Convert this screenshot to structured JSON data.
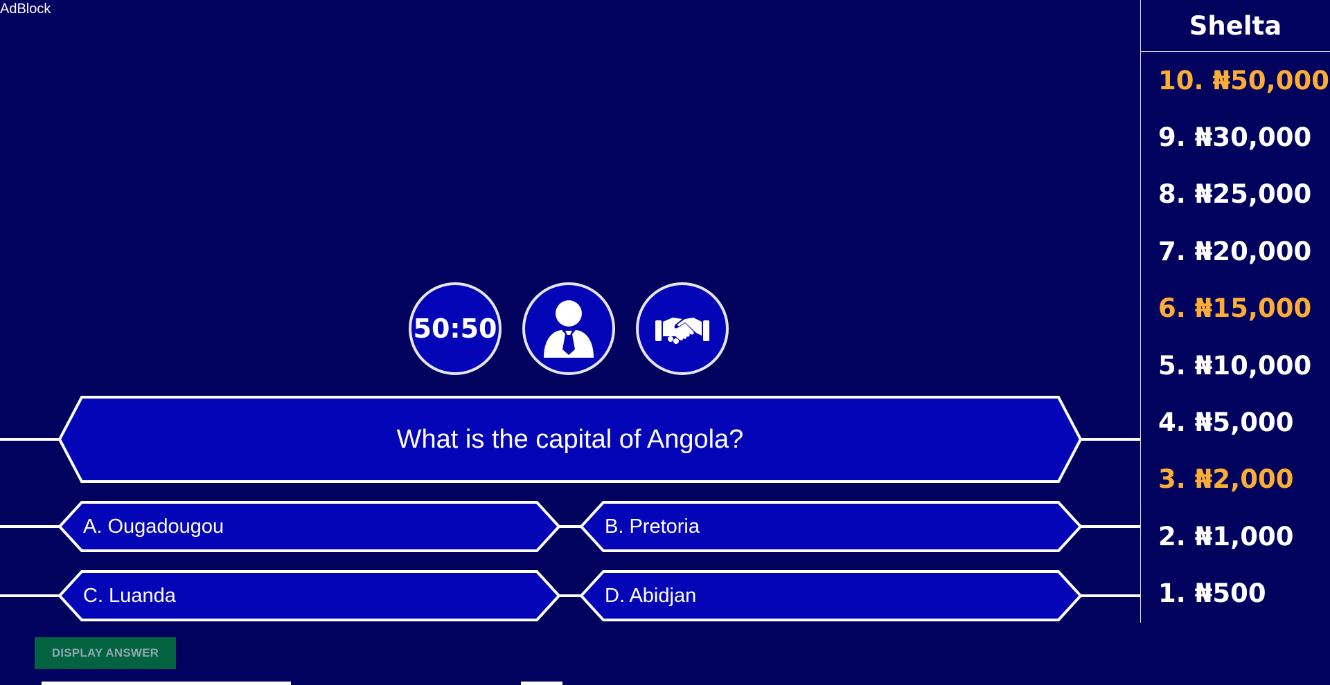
{
  "adblock_label": "AdBlock",
  "lifelines": {
    "fifty_fifty": "50:50",
    "ask_expert_icon": "person-with-tie-icon",
    "handshake_icon": "handshake-icon"
  },
  "question": {
    "text": "What is the capital of Angola?"
  },
  "answers": {
    "a": "A. Ougadougou",
    "b": "B. Pretoria",
    "c": "C. Luanda",
    "d": "D. Abidjan"
  },
  "display_answer_button": "DISPLAY ANSWER",
  "ladder": {
    "title": "Shelta",
    "items": [
      {
        "label": "10. ₦50,000",
        "milestone": true
      },
      {
        "label": "9. ₦30,000",
        "milestone": false
      },
      {
        "label": "8. ₦25,000",
        "milestone": false
      },
      {
        "label": "7. ₦20,000",
        "milestone": false
      },
      {
        "label": "6. ₦15,000",
        "milestone": true
      },
      {
        "label": "5. ₦10,000",
        "milestone": false
      },
      {
        "label": "4. ₦5,000",
        "milestone": false
      },
      {
        "label": "3. ₦2,000",
        "milestone": true
      },
      {
        "label": "2. ₦1,000",
        "milestone": false
      },
      {
        "label": "1. ₦500",
        "milestone": false
      }
    ]
  },
  "colors": {
    "background": "#01015e",
    "panel": "#0505b8",
    "milestone": "#fbad35",
    "button": "#03623f"
  }
}
